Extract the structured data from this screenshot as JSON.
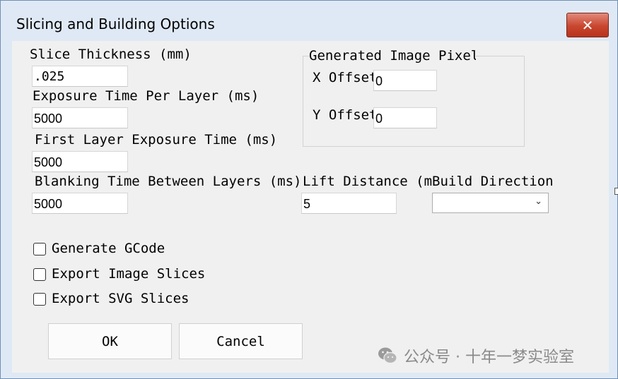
{
  "window": {
    "title": "Slicing and Building Options",
    "close_glyph": "✕"
  },
  "fields": {
    "slice_thickness": {
      "label": "Slice Thickness (mm)",
      "value": ".025"
    },
    "exposure_time": {
      "label": "Exposure Time Per Layer (ms)",
      "value": "5000"
    },
    "first_layer_exposure": {
      "label": "First Layer Exposure Time (ms)",
      "value": "5000"
    },
    "blanking_time": {
      "label": "Blanking Time Between Layers (ms)",
      "value": "5000"
    },
    "lift_distance": {
      "label": "Lift Distance (mm)",
      "value": "5"
    },
    "build_direction": {
      "label": "Build Direction",
      "value": ""
    }
  },
  "offsets_group": {
    "caption": "Generated Image Pixel Offsets",
    "x_label": "X Offset",
    "x_value": "0",
    "y_label": "Y Offset",
    "y_value": "0"
  },
  "checkboxes": [
    {
      "label": "Generate GCode",
      "checked": false
    },
    {
      "label": "Export Image Slices",
      "checked": false
    },
    {
      "label": "Export SVG Slices",
      "checked": false
    }
  ],
  "buttons": {
    "ok": "OK",
    "cancel": "Cancel"
  },
  "watermark": {
    "text": "公众号 · 十年一梦实验室",
    "icon": "wechat-icon"
  },
  "colors": {
    "title_bar": "#dfe9f5",
    "client_bg": "#f0f0f0",
    "close_red": "#c9462f"
  }
}
